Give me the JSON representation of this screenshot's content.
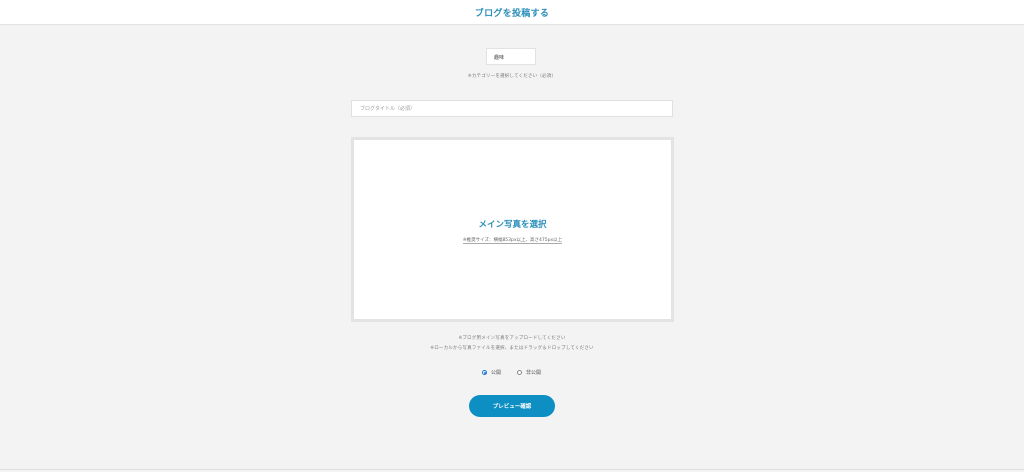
{
  "header": {
    "title": "ブログを投稿する"
  },
  "category": {
    "selected": "趣味",
    "note": "※カテゴリーを選択してください（必須）"
  },
  "title_field": {
    "placeholder": "ブログタイトル（必須）",
    "value": ""
  },
  "photo": {
    "label": "メイン写真を選択",
    "size_note": "※推奨サイズ：横幅853px以上、高さ475px以上"
  },
  "upload_notes": {
    "line1": "※ブログ用メイン写真をアップロードしてください",
    "line2": "※ローカルから写真ファイルを選択、またはドラッグ＆ドロップしてください"
  },
  "visibility": {
    "public_label": "公開",
    "private_label": "非公開",
    "selected": "公開"
  },
  "actions": {
    "preview_label": "プレビュー確認"
  },
  "colors": {
    "accent": "#2a8fb8",
    "button": "#0e8fc4",
    "background": "#f3f3f3"
  }
}
